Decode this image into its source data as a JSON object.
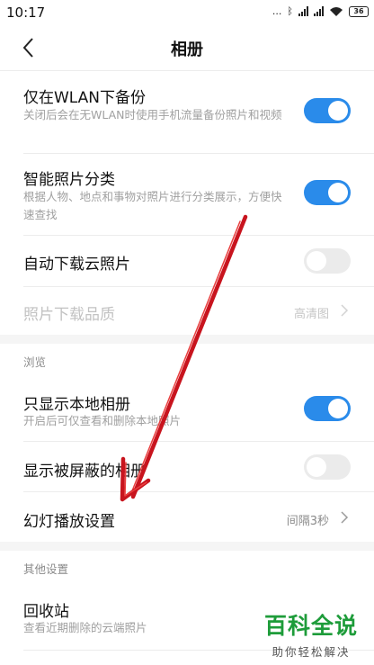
{
  "status_bar": {
    "time": "10:17",
    "dots": "...",
    "battery": "36"
  },
  "header": {
    "title": "相册"
  },
  "settings": [
    {
      "title": "仅在WLAN下备份",
      "desc": "关闭后会在无WLAN时使用手机流量备份照片和视频",
      "toggle": "on"
    },
    {
      "title": "智能照片分类",
      "desc": "根据人物、地点和事物对照片进行分类展示，方便快速查找",
      "toggle": "on"
    },
    {
      "title": "自动下载云照片",
      "toggle": "off"
    },
    {
      "title": "照片下载品质",
      "value": "高清图",
      "disabled": true
    }
  ],
  "browse": {
    "header": "浏览",
    "items": [
      {
        "title": "只显示本地相册",
        "desc": "开启后可仅查看和删除本地照片",
        "toggle": "on"
      },
      {
        "title": "显示被屏蔽的相册",
        "toggle": "off"
      },
      {
        "title": "幻灯播放设置",
        "value": "间隔3秒"
      }
    ]
  },
  "other": {
    "header": "其他设置",
    "items": [
      {
        "title": "回收站",
        "desc": "查看近期删除的云端照片"
      }
    ]
  },
  "watermark": {
    "main": "百科全说",
    "sub": "助你轻松解决"
  },
  "colors": {
    "accent": "#2a8bea",
    "annotation_arrow": "#c8141e",
    "watermark": "#1e9c3a"
  }
}
